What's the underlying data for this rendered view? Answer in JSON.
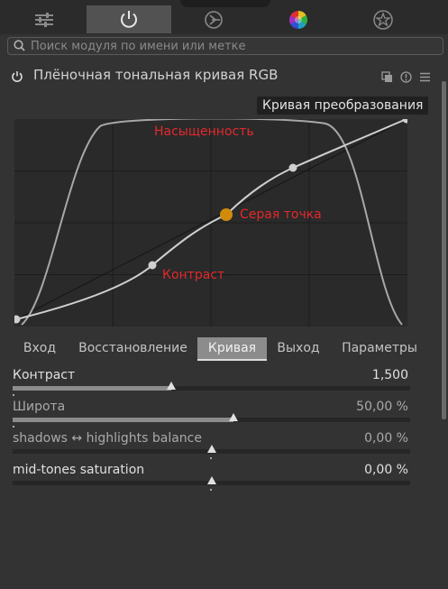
{
  "top_tabs": [
    {
      "icon": "sliders-icon",
      "active": false
    },
    {
      "icon": "power-icon",
      "active": true
    },
    {
      "icon": "circle-arrow-icon",
      "active": false
    },
    {
      "icon": "color-wheel-icon",
      "active": false
    },
    {
      "icon": "star-icon",
      "active": false
    }
  ],
  "search": {
    "placeholder": "Поиск модуля по имени или метке"
  },
  "module": {
    "title": "Плёночная тональная кривая RGB"
  },
  "graph": {
    "curve_tag": "Кривая преобразования",
    "label_saturation": "Насыщенность",
    "label_grey_point": "Серая точка",
    "label_contrast": "Контраст",
    "colors": {
      "curve": "#c8c8c8",
      "grey_point": "#d18b0a",
      "labels": "#e2292c"
    }
  },
  "tabs": [
    {
      "label": "Вход",
      "active": false
    },
    {
      "label": "Восстановление",
      "active": false
    },
    {
      "label": "Кривая",
      "active": true
    },
    {
      "label": "Выход",
      "active": false
    },
    {
      "label": "Параметры",
      "active": false
    }
  ],
  "sliders": [
    {
      "label": "Контраст",
      "value": "1,500",
      "fraction": 0.4
    },
    {
      "label": "Широта",
      "value": "50,00 %",
      "fraction": 0.555
    },
    {
      "label": "shadows ↔ highlights balance",
      "value": "0,00 %",
      "fraction": 0.5
    },
    {
      "label": "mid-tones saturation",
      "value": "0,00 %",
      "fraction": 0.5
    }
  ]
}
